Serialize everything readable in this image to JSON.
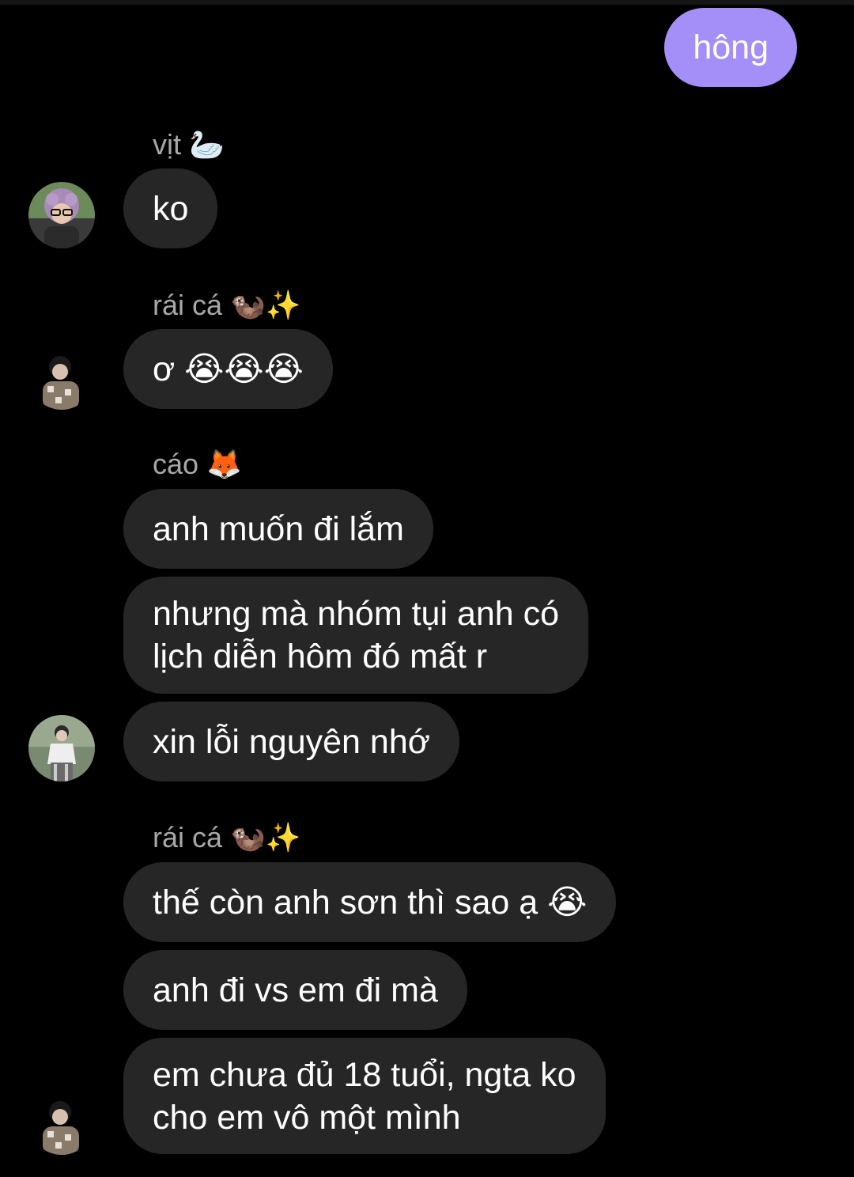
{
  "outgoing": {
    "text": "hông"
  },
  "groups": [
    {
      "sender": "vịt 🦢",
      "messages": [
        "ko"
      ]
    },
    {
      "sender": "rái cá 🦦✨",
      "messages": [
        "ơ 😭😭😭"
      ]
    },
    {
      "sender": "cáo 🦊",
      "messages": [
        "anh muốn đi lắm",
        "nhưng mà nhóm tụi anh có\nlịch diễn hôm đó mất r",
        "xin lỗi nguyên nhớ"
      ]
    },
    {
      "sender": "rái cá 🦦✨",
      "messages": [
        "thế còn anh sơn thì sao ạ 😭",
        "anh đi vs em đi mà",
        "em chưa đủ 18 tuổi, ngta ko\ncho em vô một mình"
      ]
    }
  ],
  "colors": {
    "background": "#000000",
    "incoming_bubble": "#262626",
    "outgoing_bubble": "#a48ef7",
    "sender_label": "#a8a8a8"
  }
}
